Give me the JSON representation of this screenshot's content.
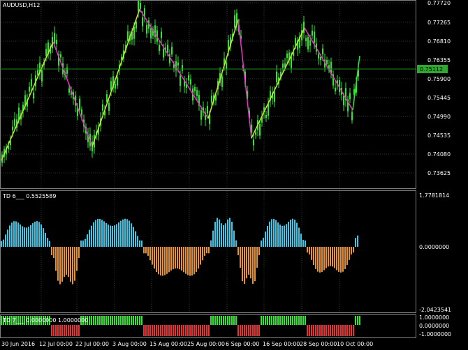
{
  "window": {
    "symbol_label": "AUDUSD,H12"
  },
  "price_panel": {
    "ticks": [
      "0.77720",
      "0.77265",
      "0.76810",
      "0.76355",
      "0.75900",
      "0.75445",
      "0.74990",
      "0.74535",
      "0.74080",
      "0.73625"
    ],
    "current_price": "0.75112"
  },
  "td6_panel": {
    "label": "TD 6___ 0.5525589",
    "ticks": [
      "1.7781814",
      "0.0000000",
      "-2.0423541"
    ]
  },
  "td7_panel": {
    "label": "TD 7___ 0.0000000 1.0000000",
    "ticks": [
      "1.0000000",
      "0.0000000",
      "-1.0000000"
    ]
  },
  "time_axis": {
    "labels": [
      "30 Jun 2016",
      "12 Jul 00:00",
      "22 Jul 00:00",
      "3 Aug 00:00",
      "15 Aug 00:00",
      "25 Aug 00:00",
      "6 Sep 00:00",
      "16 Sep 00:00",
      "28 Sep 00:00",
      "10 Oct 00:00"
    ]
  },
  "colors": {
    "background": "#000000",
    "grid": "#2b3a2b",
    "candle": "#2ee82e",
    "zigzag_up": "#c8e832",
    "zigzag_down": "#e832c8",
    "price_line": "#1a8a1a",
    "price_box": "#2ea82e",
    "hist_pos": "#3ec8e8",
    "hist_neg": "#e8922e",
    "td7_pos": "#2ee82e",
    "td7_neg": "#e83232"
  }
}
